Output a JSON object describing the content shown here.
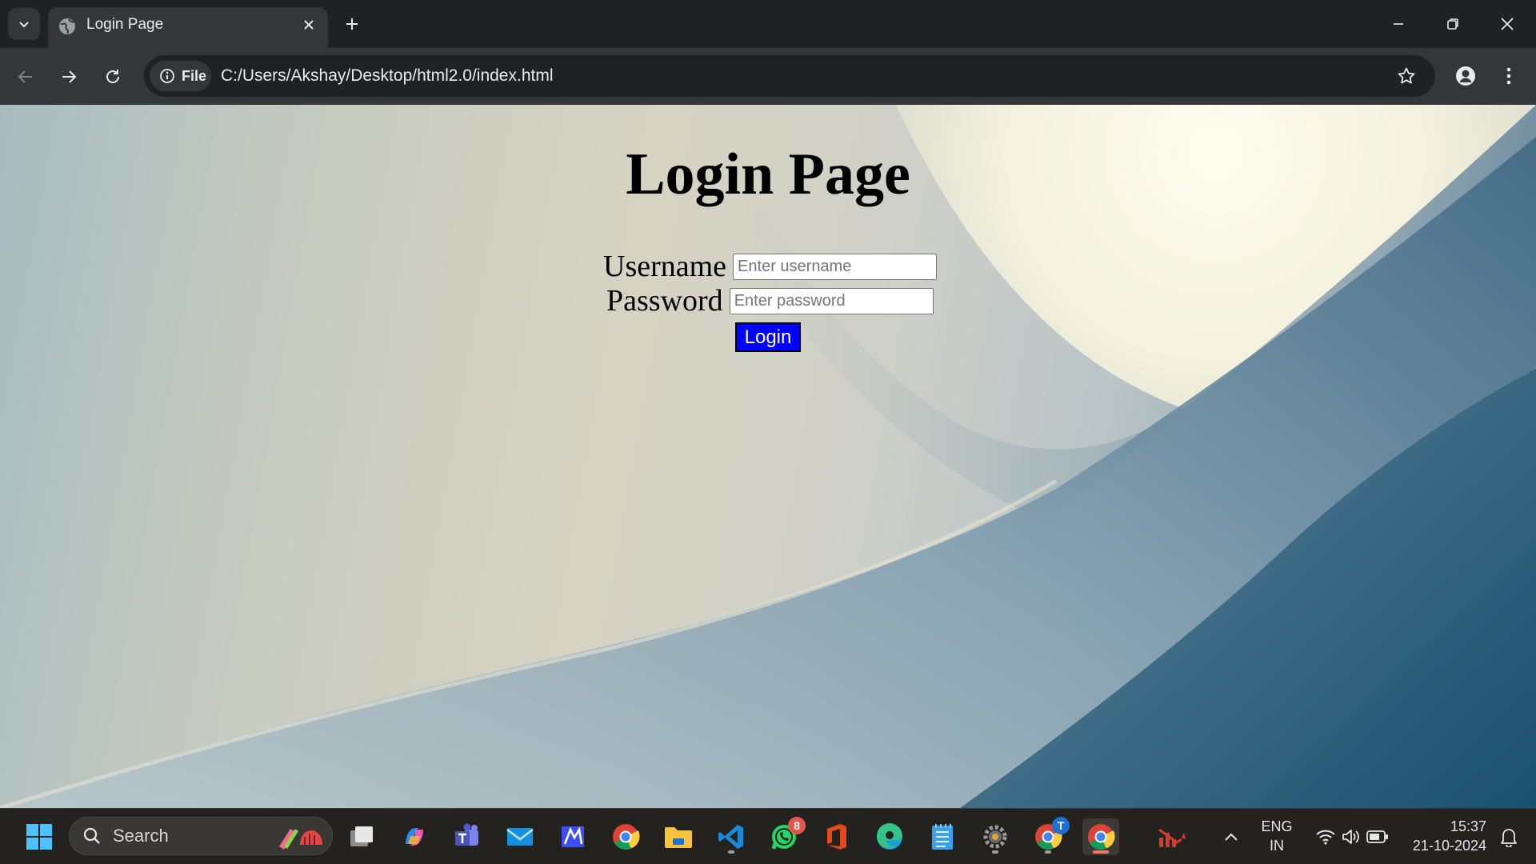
{
  "browser": {
    "tab_title": "Login Page",
    "chip_label": "File",
    "url": "C:/Users/Akshay/Desktop/html2.0/index.html"
  },
  "page": {
    "title": "Login Page",
    "username_label": "Username",
    "username_placeholder": "Enter username",
    "password_label": "Password",
    "password_placeholder": "Enter password",
    "login_label": "Login",
    "button_color": "#0000ff"
  },
  "taskbar": {
    "search_label": "Search",
    "whatsapp_badge": "8",
    "chrome_profile_badge": "T",
    "language_top": "ENG",
    "language_bottom": "IN",
    "time": "15:37",
    "date": "21-10-2024",
    "apps": [
      "start-icon",
      "task-view-icon",
      "copilot-icon",
      "teams-icon",
      "mail-icon",
      "app-icon",
      "chrome-icon",
      "file-explorer-icon",
      "vscode-icon",
      "whatsapp-icon",
      "office-icon",
      "edge-icon",
      "notepad-icon",
      "settings-icon",
      "chrome-profile-icon",
      "chrome-active-icon",
      "analytics-icon"
    ]
  }
}
